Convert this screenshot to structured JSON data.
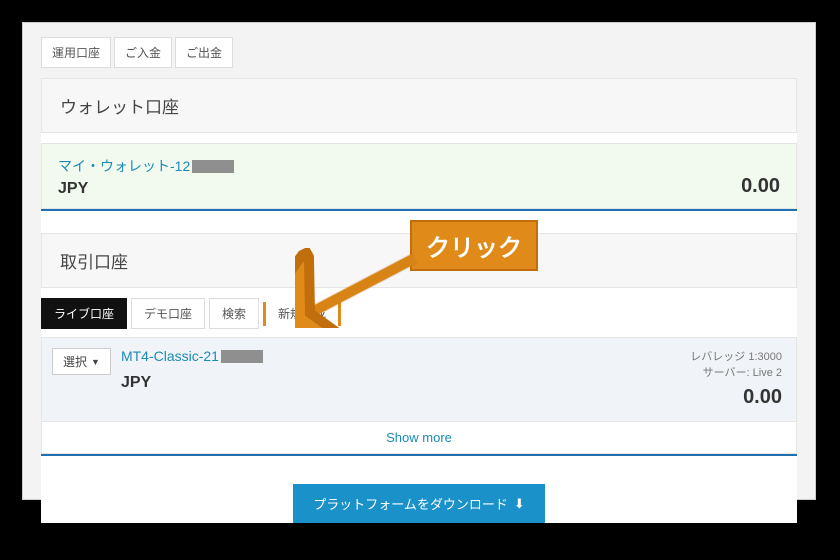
{
  "topTabs": {
    "t0": "運用口座",
    "t1": "ご入金",
    "t2": "ご出金"
  },
  "wallet": {
    "header": "ウォレット口座",
    "namePrefix": "マイ・ウォレット-12",
    "currency": "JPY",
    "amount": "0.00"
  },
  "trading": {
    "header": "取引口座",
    "tabs": {
      "live": "ライブ口座",
      "demo": "デモ口座",
      "search": "検索",
      "new": "新規作成"
    },
    "selectLabel": "選択",
    "account": {
      "namePrefix": "MT4-Classic-21",
      "currency": "JPY",
      "leverageLabel": "レバレッジ",
      "leverageValue": "1:3000",
      "serverLabel": "サーバー:",
      "serverValue": "Live 2",
      "amount": "0.00"
    },
    "showMore": "Show more"
  },
  "download": {
    "label": "プラットフォームをダウンロード"
  },
  "callout": {
    "text": "クリック"
  }
}
